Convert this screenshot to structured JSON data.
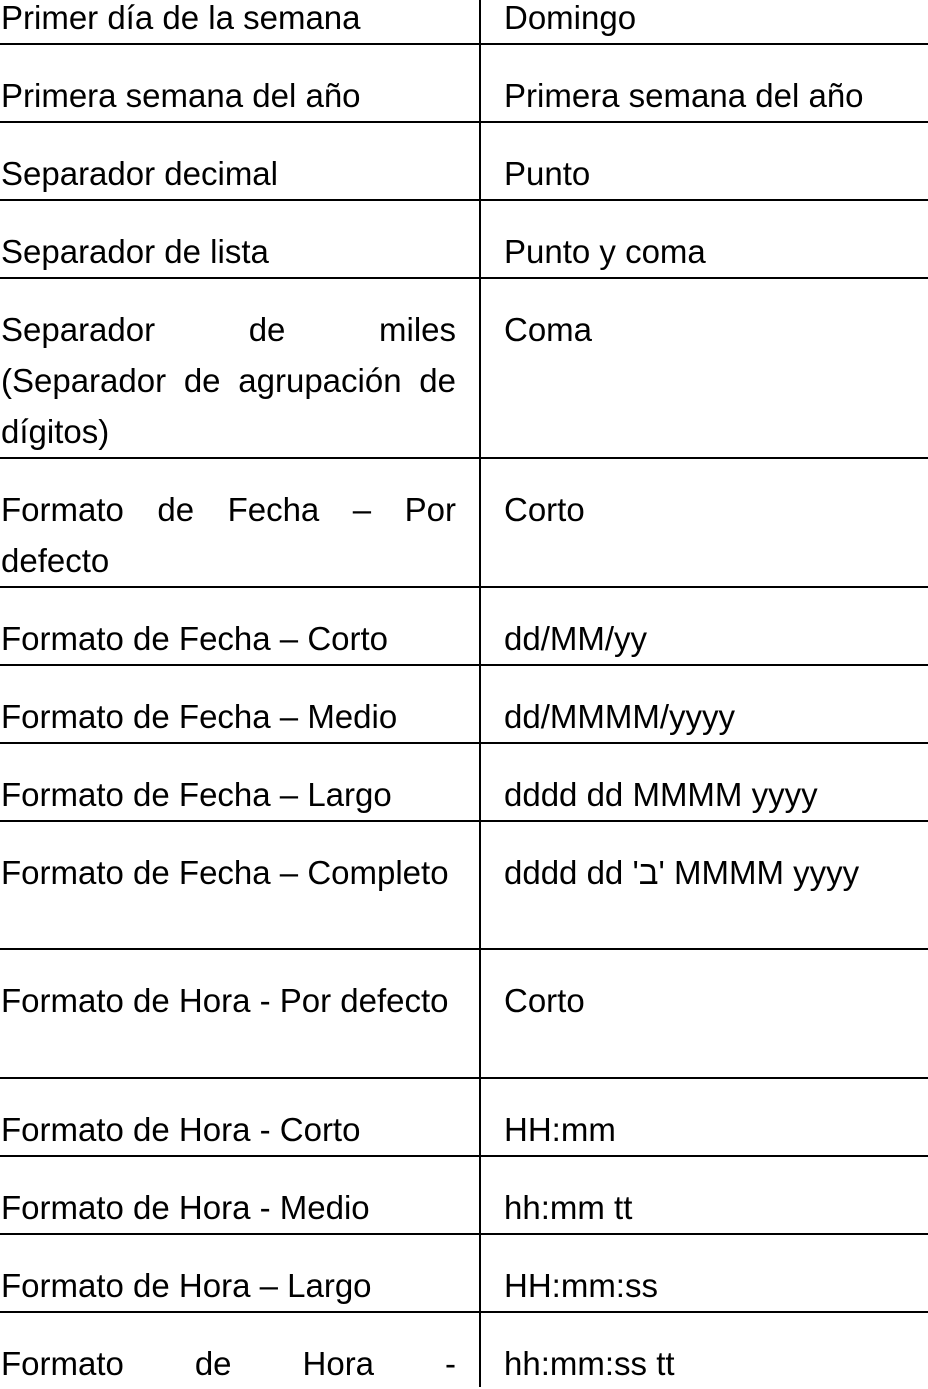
{
  "rows": [
    {
      "label": "Primer día de la semana",
      "value": "Domingo"
    },
    {
      "label": "Primera semana del año",
      "value": "Primera semana del año"
    },
    {
      "label": "Separador decimal",
      "value": "Punto"
    },
    {
      "label": "Separador de lista",
      "value": "Punto y coma"
    },
    {
      "label": "Separador de miles (Separador de agrupación de dígitos)",
      "value": "Coma"
    },
    {
      "label": "Formato de Fecha – Por defecto",
      "value": "Corto"
    },
    {
      "label": "Formato de Fecha – Corto",
      "value": "dd/MM/yy"
    },
    {
      "label": "Formato de Fecha – Medio",
      "value": "dd/MMMM/yyyy"
    },
    {
      "label": "Formato de Fecha – Largo",
      "value": "dddd dd MMMM yyyy"
    },
    {
      "label": "Formato de Fecha – Completo",
      "value": "dddd dd 'ב' MMMM yyyy"
    },
    {
      "label": "Formato de Hora - Por defecto",
      "value": "Corto"
    },
    {
      "label": "Formato de Hora - Corto",
      "value": "HH:mm"
    },
    {
      "label": "Formato de Hora - Medio",
      "value": "hh:mm tt"
    },
    {
      "label": "Formato de Hora – Largo",
      "value": "HH:mm:ss"
    },
    {
      "label": "Formato de Hora -",
      "value": "hh:mm:ss tt"
    }
  ]
}
